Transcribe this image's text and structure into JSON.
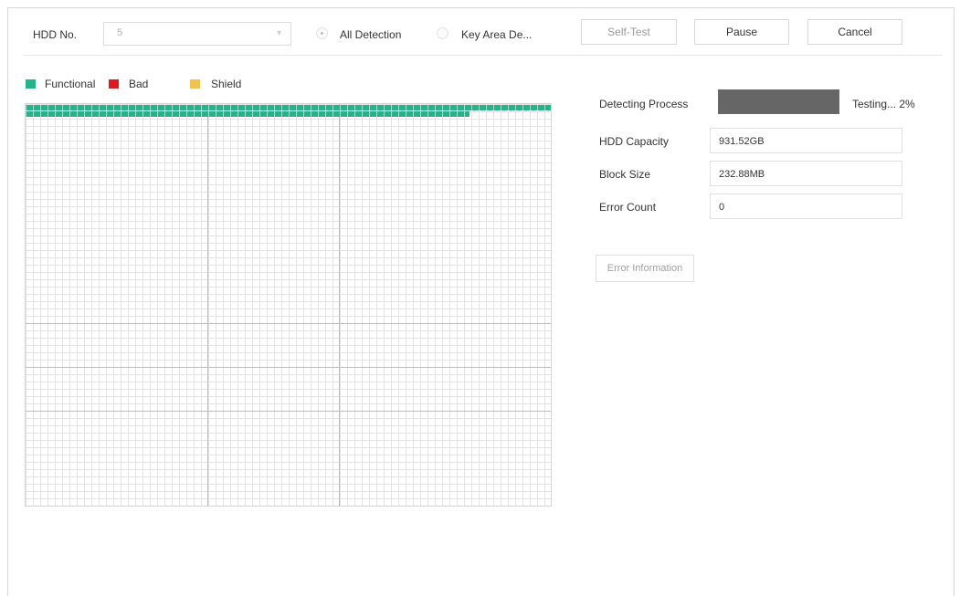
{
  "toolbar": {
    "hdd_label": "HDD No.",
    "hdd_value": "5",
    "detection_modes": [
      {
        "label": "All Detection",
        "checked": true
      },
      {
        "label": "Key Area De...",
        "checked": false
      }
    ],
    "self_test_label": "Self-Test",
    "pause_label": "Pause",
    "cancel_label": "Cancel"
  },
  "legend": [
    {
      "label": "Functional",
      "color": "#25b48a"
    },
    {
      "label": "Bad",
      "color": "#e0191e"
    },
    {
      "label": "Shield",
      "color": "#f2c14e"
    }
  ],
  "block_map": {
    "functional_color": "#25b48a",
    "progress_fraction": 0.02
  },
  "details": {
    "detecting_process_label": "Detecting Process",
    "progress_percent": 100,
    "status_text": "Testing... 2%",
    "fields": [
      {
        "label": "HDD Capacity",
        "value": "931.52GB"
      },
      {
        "label": "Block Size",
        "value": "232.88MB"
      },
      {
        "label": "Error Count",
        "value": "0"
      }
    ],
    "error_info_label": "Error Information"
  }
}
